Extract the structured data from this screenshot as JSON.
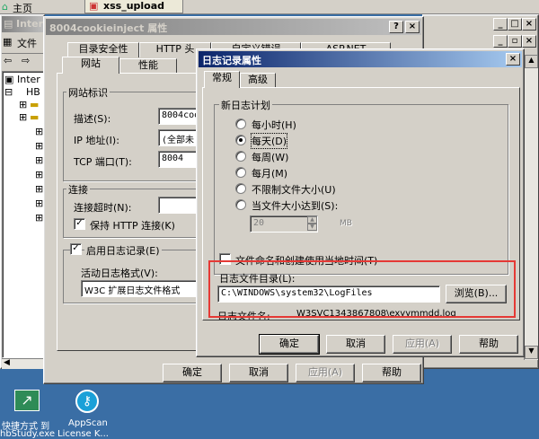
{
  "taskbar": {
    "tab1": "主页",
    "tab2": "xss_upload"
  },
  "mmc": {
    "title": "Inter",
    "menu_file": "文件",
    "tree_root": "Inter",
    "tree_node": "HB"
  },
  "desktop": {
    "icon1_line1": "快捷方式 到",
    "icon1_line2": "hbStudy.exe",
    "icon2_line1": "AppScan",
    "icon2_line2": "License K..."
  },
  "props": {
    "title": "8004cookieinject 属性",
    "tabs_back": [
      "目录安全性",
      "HTTP 头",
      "自定义错误",
      "ASP.NET"
    ],
    "tabs_front": [
      "网站",
      "性能"
    ],
    "group_id": "网站标识",
    "desc_label": "描述(S):",
    "desc_value": "8004coo",
    "ip_label": "IP 地址(I):",
    "ip_value": "(全部未",
    "tcp_label": "TCP 端口(T):",
    "tcp_value": "8004",
    "group_conn": "连接",
    "timeout_label": "连接超时(N):",
    "keepalive_label": "保持 HTTP 连接(K)",
    "logging_label": "启用日志记录(E)",
    "log_format_label": "活动日志格式(V):",
    "log_format_value": "W3C 扩展日志文件格式",
    "ok": "确定",
    "cancel": "取消",
    "apply": "应用(A)",
    "help": "帮助"
  },
  "log": {
    "title": "日志记录属性",
    "tab_general": "常规",
    "tab_advanced": "高级",
    "group_schedule": "新日志计划",
    "radio_hourly": "每小时(H)",
    "radio_daily": "每天(D)",
    "radio_weekly": "每周(W)",
    "radio_monthly": "每月(M)",
    "radio_unlimited": "不限制文件大小(U)",
    "radio_size": "当文件大小达到(S):",
    "size_value": "20",
    "size_unit": "MB",
    "localtime_label": "文件命名和创建使用当地时间(T)",
    "dir_label": "日志文件目录(L):",
    "dir_value": "C:\\WINDOWS\\system32\\LogFiles",
    "browse": "浏览(B)...",
    "filename_label": "日志文件名:",
    "filename_value": "W3SVC1343867808\\exyymmdd.log",
    "ok": "确定",
    "cancel": "取消",
    "apply": "应用(A)",
    "help": "帮助"
  },
  "colors": {
    "highlight_box": "#e53935",
    "active_title": "#0a246a",
    "face": "#d4d0c8"
  }
}
